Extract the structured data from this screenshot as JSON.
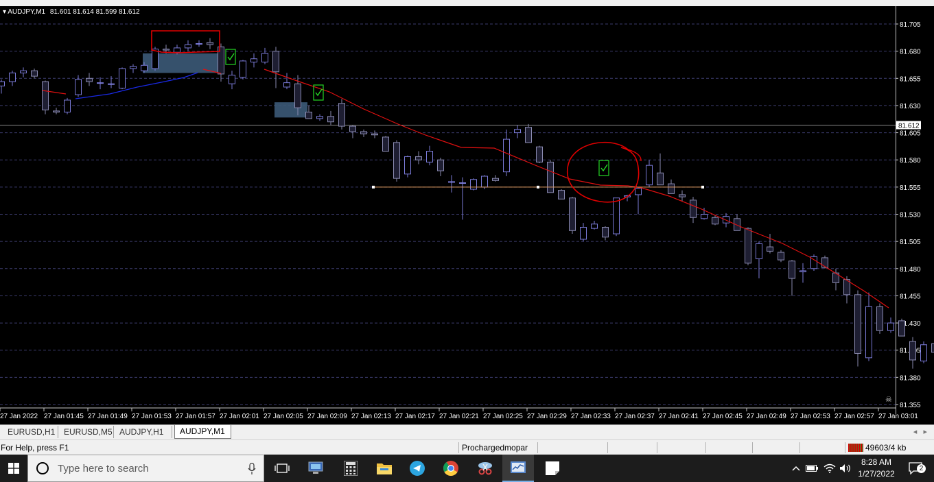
{
  "chart": {
    "symbol": "AUDJPY,M1",
    "ohlc": "81.601 81.614 81.599 81.612",
    "current_price_label": "81.612",
    "price_labels": [
      "81.705",
      "81.680",
      "81.655",
      "81.630",
      "81.605",
      "81.580",
      "81.555",
      "81.530",
      "81.505",
      "81.480",
      "81.455",
      "81.430",
      "81.405",
      "81.380",
      "81.355"
    ],
    "time_labels": [
      "27 Jan 2022",
      "27 Jan 01:45",
      "27 Jan 01:49",
      "27 Jan 01:53",
      "27 Jan 01:57",
      "27 Jan 02:01",
      "27 Jan 02:05",
      "27 Jan 02:09",
      "27 Jan 02:13",
      "27 Jan 02:17",
      "27 Jan 02:21",
      "27 Jan 02:25",
      "27 Jan 02:29",
      "27 Jan 02:33",
      "27 Jan 02:37",
      "27 Jan 02:41",
      "27 Jan 02:45",
      "27 Jan 02:49",
      "27 Jan 02:53",
      "27 Jan 02:57",
      "27 Jan 03:01"
    ],
    "colors": {
      "background": "#000000",
      "grid": "#3c3c6e",
      "bull_candle": "#7b7bd9",
      "bear_candle": "#8a8ab0",
      "ma_red": "#e01010",
      "ma_blue": "#1a2ae8",
      "zone": "#3c5a78",
      "level_line": "#e8a060",
      "annotation": "#e00000",
      "signal_marker": "#26d826"
    }
  },
  "tabs": [
    {
      "label": "EURUSD,H1",
      "active": false
    },
    {
      "label": "EURUSD,M5",
      "active": false
    },
    {
      "label": "AUDJPY,H1",
      "active": false
    },
    {
      "label": "AUDJPY,M1",
      "active": true
    }
  ],
  "status": {
    "help": "For Help, press F1",
    "profile": "Prochargedmopar",
    "traffic": "49603/4 kb"
  },
  "taskbar": {
    "search_placeholder": "Type here to search",
    "time": "8:28 AM",
    "date": "1/27/2022",
    "notification_count": "2"
  }
}
